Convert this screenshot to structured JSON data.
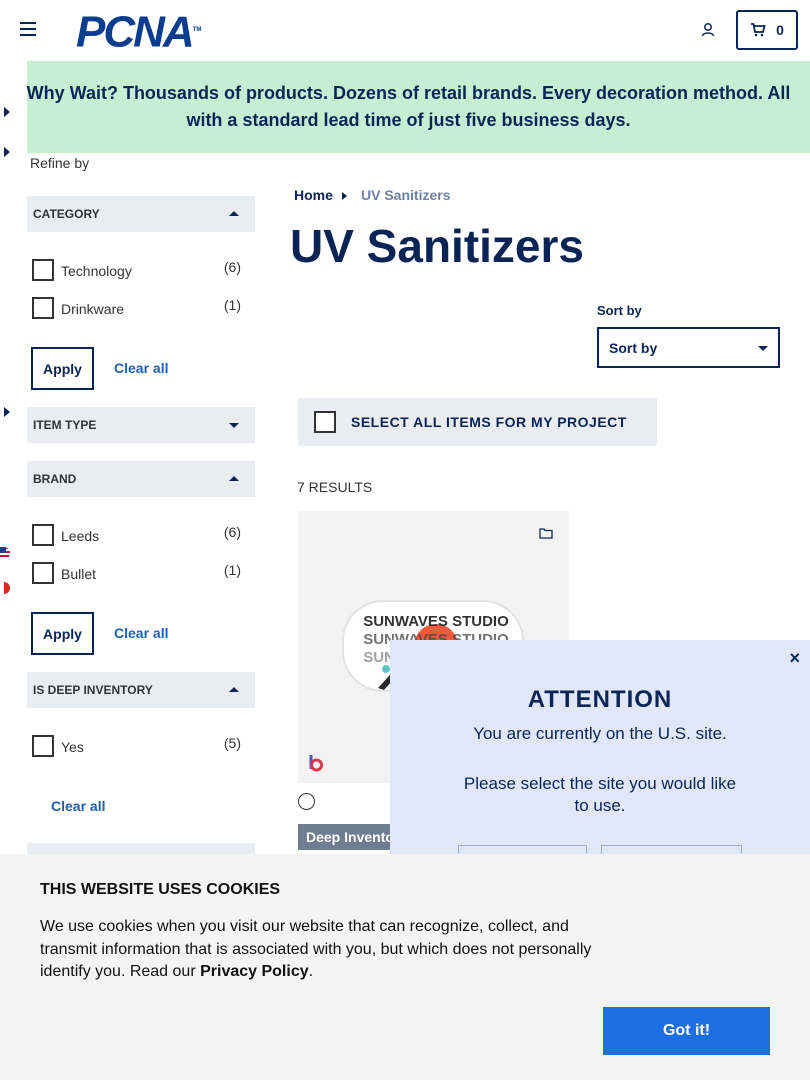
{
  "header": {
    "logo_text": "PCNA",
    "logo_tm": "TM",
    "cart_count": "0"
  },
  "banner": {
    "text": "Why Wait? Thousands of products. Dozens of retail brands. Every decoration method. All with a standard lead time of just five business days."
  },
  "sidebar": {
    "refine_label": "Refine by",
    "facets": [
      {
        "title": "CATEGORY",
        "expanded": true,
        "options": [
          {
            "label": "Technology",
            "count": "(6)"
          },
          {
            "label": "Drinkware",
            "count": "(1)"
          }
        ],
        "apply_label": "Apply",
        "clear_label": "Clear all"
      },
      {
        "title": "ITEM TYPE",
        "expanded": false
      },
      {
        "title": "BRAND",
        "expanded": true,
        "options": [
          {
            "label": "Leeds",
            "count": "(6)"
          },
          {
            "label": "Bullet",
            "count": "(1)"
          }
        ],
        "apply_label": "Apply",
        "clear_label": "Clear all"
      },
      {
        "title": "IS DEEP INVENTORY",
        "expanded": true,
        "options": [
          {
            "label": "Yes",
            "count": "(5)"
          }
        ],
        "clear_label": "Clear all"
      }
    ]
  },
  "main": {
    "breadcrumb": {
      "home": "Home",
      "current": "UV Sanitizers"
    },
    "title": "UV Sanitizers",
    "sort_label": "Sort by",
    "sort_value": "Sort by",
    "select_all_label": "SELECT ALL ITEMS FOR MY PROJECT",
    "results_label": "7 RESULTS",
    "products": [
      {
        "image_text_lines": [
          "SUNWAVES STUDIO",
          "SUNWAVES STUDIO",
          "SUNWAVES STUDIO"
        ],
        "badge": "Deep Inventory"
      }
    ]
  },
  "modal": {
    "close_label": "×",
    "title": "ATTENTION",
    "line1": "You are currently on the U.S. site.",
    "line2": "Please select the site you would like to use."
  },
  "cookie": {
    "title": "THIS WEBSITE USES COOKIES",
    "text_before": "We use cookies when you visit our website that can recognize, collect, and transmit information that is associated with you, but which does not personally identify you. Read our ",
    "link": "Privacy Policy",
    "text_after": ".",
    "button": "Got it!"
  },
  "colors": {
    "navy": "#0a2456",
    "banner_green": "#c5eed3",
    "facet_grey": "#e9edf2",
    "link_blue": "#1f5fb5",
    "cookie_button": "#1b6fe3",
    "modal_bg": "#e0e8f8"
  },
  "icons": [
    "menu-icon",
    "user-icon",
    "cart-icon",
    "folder-icon",
    "bullet-brand-icon",
    "us-flag-icon",
    "canada-flag-icon"
  ]
}
